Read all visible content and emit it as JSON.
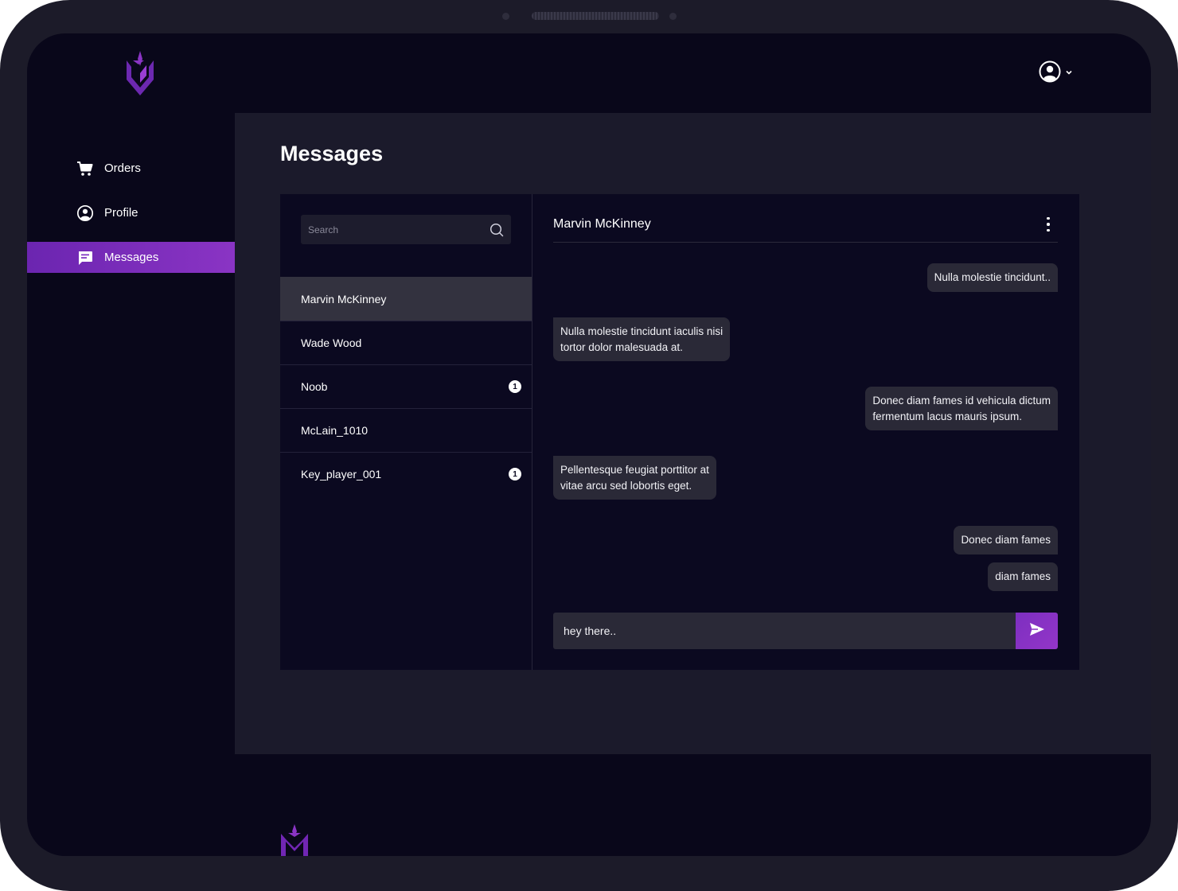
{
  "sidebar": {
    "items": [
      {
        "label": "Orders",
        "icon": "cart-icon",
        "active": false
      },
      {
        "label": "Profile",
        "icon": "user-circle-icon",
        "active": false
      },
      {
        "label": "Messages",
        "icon": "chat-icon",
        "active": true
      }
    ]
  },
  "header": {
    "user_icon": "user-circle-icon",
    "dropdown_icon": "chevron-down-icon"
  },
  "main": {
    "title": "Messages"
  },
  "search": {
    "placeholder": "Search",
    "icon": "search-icon"
  },
  "conversations": [
    {
      "name": "Marvin McKinney",
      "unread": null,
      "selected": true
    },
    {
      "name": "Wade Wood",
      "unread": null,
      "selected": false
    },
    {
      "name": "Noob",
      "unread": "1",
      "selected": false
    },
    {
      "name": "McLain_1010",
      "unread": null,
      "selected": false
    },
    {
      "name": "Key_player_001",
      "unread": "1",
      "selected": false
    }
  ],
  "chat": {
    "title": "Marvin McKinney",
    "messages": [
      {
        "direction": "outgoing",
        "lines": [
          "Nulla molestie tincidunt.."
        ]
      },
      {
        "direction": "incoming",
        "lines": [
          "Nulla molestie tincidunt iaculis nisi",
          "tortor dolor malesuada at."
        ]
      },
      {
        "direction": "outgoing",
        "lines": [
          "Donec diam fames id vehicula dictum",
          "fermentum lacus mauris ipsum."
        ]
      },
      {
        "direction": "incoming",
        "lines": [
          "Pellentesque feugiat porttitor at",
          "vitae arcu sed lobortis eget."
        ]
      },
      {
        "direction": "outgoing",
        "lines": [
          "Donec diam fames"
        ]
      },
      {
        "direction": "outgoing",
        "lines": [
          "diam fames"
        ]
      }
    ],
    "composer_value": "hey there..",
    "send_icon": "send-icon"
  },
  "colors": {
    "accent": "#8a34c4",
    "screen_bg": "#09071a",
    "main_bg": "#1b1a2b",
    "panel_bg": "#0b0920",
    "bubble_bg": "#2a2937",
    "selected_row": "#33323f"
  }
}
